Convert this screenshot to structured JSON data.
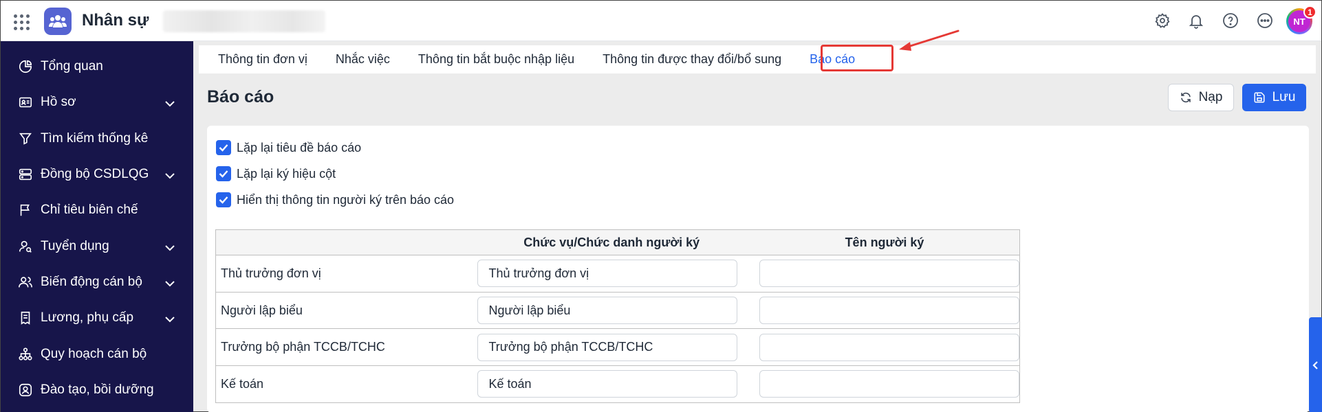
{
  "app": {
    "title": "Nhân sự"
  },
  "user": {
    "initials": "NT",
    "notification_count": "1"
  },
  "icons": {
    "apps": "apps-grid-icon",
    "logo": "people-group-icon",
    "settings": "gear-icon",
    "notifications": "bell-icon",
    "help": "help-circle-icon",
    "more": "more-horizontal-icon"
  },
  "sidebar": {
    "items": [
      {
        "label": "Tổng quan",
        "icon": "pie-chart-icon",
        "expandable": false
      },
      {
        "label": "Hồ sơ",
        "icon": "id-card-icon",
        "expandable": true
      },
      {
        "label": "Tìm kiếm thống kê",
        "icon": "filter-icon",
        "expandable": false
      },
      {
        "label": "Đồng bộ CSDLQG",
        "icon": "sync-database-icon",
        "expandable": true
      },
      {
        "label": "Chỉ tiêu biên chế",
        "icon": "flag-icon",
        "expandable": false
      },
      {
        "label": "Tuyển dụng",
        "icon": "user-search-icon",
        "expandable": true
      },
      {
        "label": "Biến động cán bộ",
        "icon": "users-icon",
        "expandable": true
      },
      {
        "label": "Lương, phụ cấp",
        "icon": "document-list-icon",
        "expandable": true
      },
      {
        "label": "Quy hoạch cán bộ",
        "icon": "org-chart-icon",
        "expandable": false
      },
      {
        "label": "Đào tạo, bồi dưỡng",
        "icon": "graduation-icon",
        "expandable": false
      }
    ]
  },
  "tabs": [
    {
      "label": "Thông tin đơn vị",
      "active": false
    },
    {
      "label": "Nhắc việc",
      "active": false
    },
    {
      "label": "Thông tin bắt buộc nhập liệu",
      "active": false
    },
    {
      "label": "Thông tin được thay đổi/bổ sung",
      "active": false
    },
    {
      "label": "Báo cáo",
      "active": true
    }
  ],
  "page": {
    "title": "Báo cáo",
    "reload_label": "Nạp",
    "save_label": "Lưu"
  },
  "options": [
    {
      "label": "Lặp lại tiêu đề báo cáo",
      "checked": true
    },
    {
      "label": "Lặp lại ký hiệu cột",
      "checked": true
    },
    {
      "label": "Hiển thị thông tin người ký trên báo cáo",
      "checked": true
    }
  ],
  "signers": {
    "headers": {
      "role": "",
      "title": "Chức vụ/Chức danh người ký",
      "name": "Tên người ký"
    },
    "rows": [
      {
        "role": "Thủ trưởng đơn vị",
        "title": "Thủ trưởng đơn vị",
        "name": ""
      },
      {
        "role": "Người lập biểu",
        "title": "Người lập biểu",
        "name": ""
      },
      {
        "role": "Trưởng bộ phận TCCB/TCHC",
        "title": "Trưởng bộ phận TCCB/TCHC",
        "name": ""
      },
      {
        "role": "Kế toán",
        "title": "Kế toán",
        "name": ""
      }
    ]
  },
  "colors": {
    "primary": "#2563eb",
    "sidebar_bg": "#17154a",
    "annotation": "#e53935"
  }
}
